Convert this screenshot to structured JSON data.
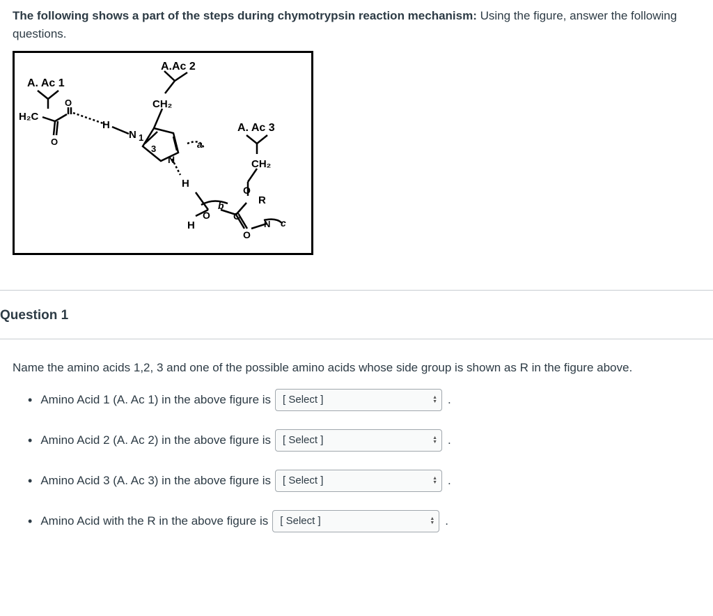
{
  "intro": {
    "bold": "The following shows a part of the steps during chymotrypsin reaction mechanism:",
    "rest": " Using the figure, answer the following questions."
  },
  "figure": {
    "labels": {
      "aac1": "A. Ac 1",
      "aac2": "A.Ac 2",
      "aac3": "A. Ac 3",
      "h2c": "H₂C",
      "ch2_top": "CH₂",
      "ch2_right": "CH₂",
      "n1": "N 1",
      "h_left": "H",
      "h_mid": "H",
      "h_bottom": "H",
      "o_left": "O",
      "o_right": "O",
      "r": "R",
      "n_ring": "N",
      "three": "3",
      "a": "a",
      "b": "b",
      "c": "c"
    }
  },
  "question": {
    "heading": "Question 1",
    "text": "Name the amino acids 1,2, 3 and one of the possible amino acids whose side group is shown as R in the figure above.",
    "items": [
      {
        "label": "Amino Acid 1 (A. Ac 1) in the above figure is",
        "select": "[ Select ]"
      },
      {
        "label": "Amino Acid 2 (A. Ac 2) in the above figure is",
        "select": "[ Select ]"
      },
      {
        "label": "Amino Acid 3 (A. Ac 3) in the above figure is",
        "select": "[ Select ]"
      },
      {
        "label": "Amino Acid with the R in the above figure is",
        "select": "[ Select ]"
      }
    ]
  }
}
